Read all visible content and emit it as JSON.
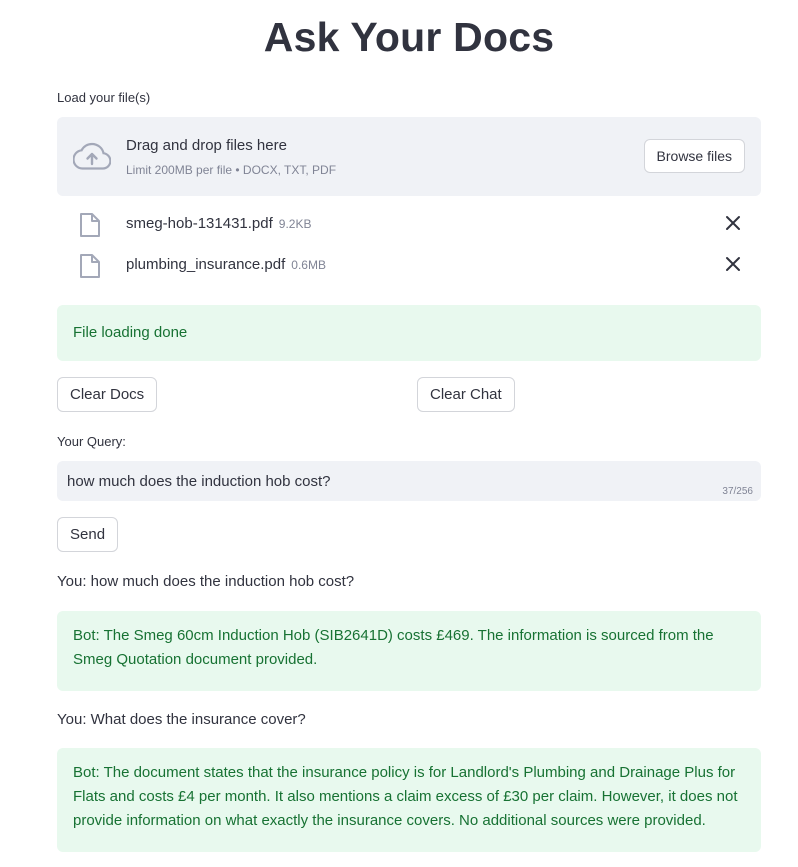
{
  "page": {
    "title": "Ask Your Docs"
  },
  "uploader": {
    "label": "Load your file(s)",
    "drop_title": "Drag and drop files here",
    "drop_sub": "Limit 200MB per file • DOCX, TXT, PDF",
    "browse_label": "Browse files",
    "files": [
      {
        "name": "smeg-hob-131431.pdf",
        "size": "9.2KB"
      },
      {
        "name": "plumbing_insurance.pdf",
        "size": "0.6MB"
      }
    ]
  },
  "status": {
    "message": "File loading done"
  },
  "actions": {
    "clear_docs": "Clear Docs",
    "clear_chat": "Clear Chat"
  },
  "query": {
    "label": "Your Query:",
    "value": "how much does the induction hob cost?",
    "count": "37/256",
    "send_label": "Send"
  },
  "chat": [
    {
      "you": "You: how much does the induction hob cost?",
      "bot": "Bot: The Smeg 60cm Induction Hob (SIB2641D) costs £469. The information is sourced from the Smeg Quotation document provided."
    },
    {
      "you": "You: What does the insurance cover?",
      "bot": "Bot: The document states that the insurance policy is for Landlord's Plumbing and Drainage Plus for Flats and costs £4 per month. It also mentions a claim excess of £30 per claim. However, it does not provide information on what exactly the insurance covers. No additional sources were provided."
    }
  ],
  "colors": {
    "text": "#31333f",
    "muted": "#808495",
    "panel": "#f0f2f6",
    "success_bg": "#e8f9ee",
    "success_text": "#177233"
  }
}
